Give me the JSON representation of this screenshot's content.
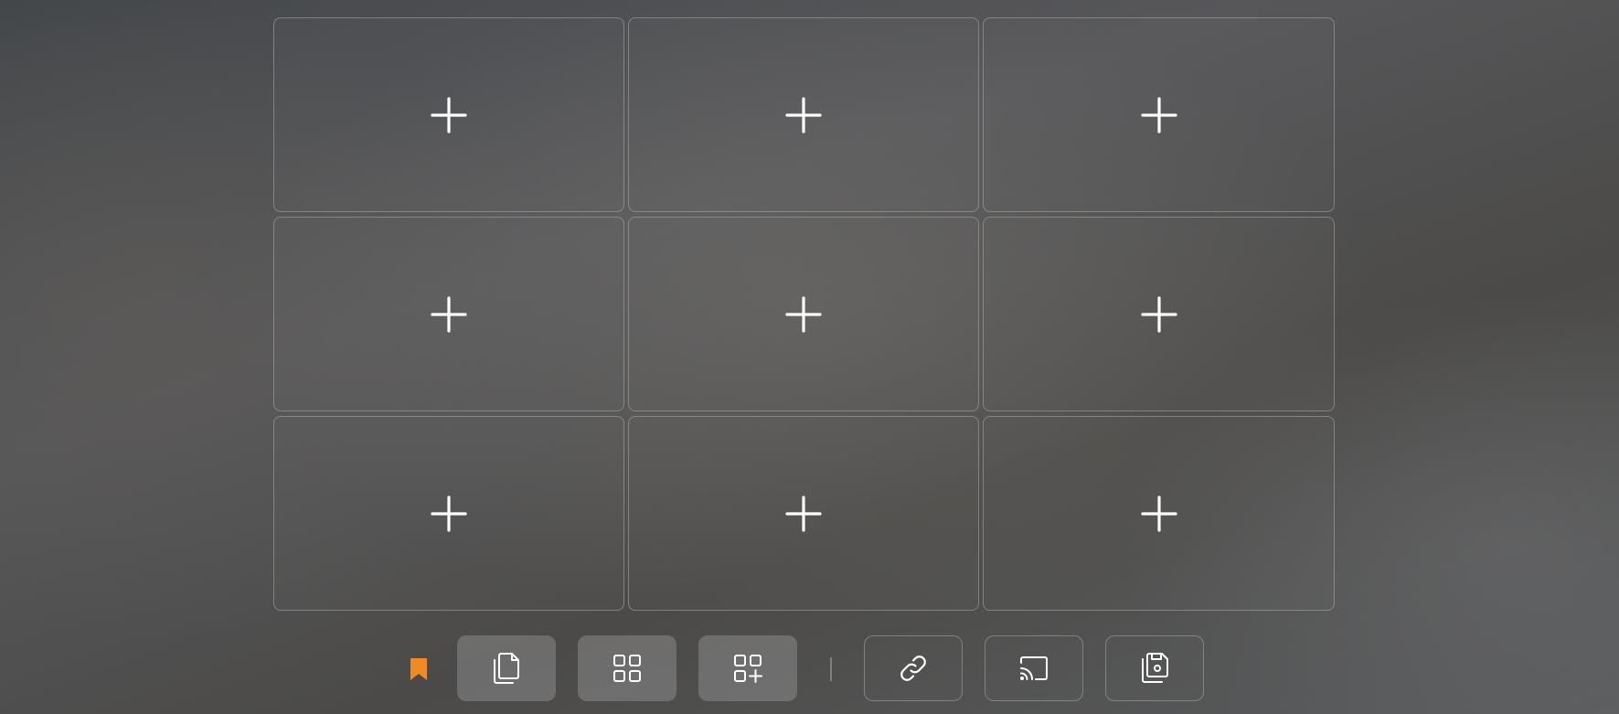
{
  "grid": {
    "slots": [
      {
        "icon": "plus-icon"
      },
      {
        "icon": "plus-icon"
      },
      {
        "icon": "plus-icon"
      },
      {
        "icon": "plus-icon"
      },
      {
        "icon": "plus-icon"
      },
      {
        "icon": "plus-icon"
      },
      {
        "icon": "plus-icon"
      },
      {
        "icon": "plus-icon"
      },
      {
        "icon": "plus-icon"
      }
    ]
  },
  "toolbar": {
    "bookmark": {
      "icon": "bookmark-icon",
      "color": "#f08a24"
    },
    "buttons": [
      {
        "icon": "copy-pages-icon",
        "style": "filled"
      },
      {
        "icon": "grid-layout-icon",
        "style": "filled"
      },
      {
        "icon": "grid-add-icon",
        "style": "filled"
      },
      {
        "icon": "link-icon",
        "style": "outline"
      },
      {
        "icon": "cast-icon",
        "style": "outline"
      },
      {
        "icon": "save-copies-icon",
        "style": "outline"
      }
    ]
  },
  "colors": {
    "icon": "#ffffff",
    "accent": "#f08a24",
    "cell_border": "#aaaaaa"
  }
}
